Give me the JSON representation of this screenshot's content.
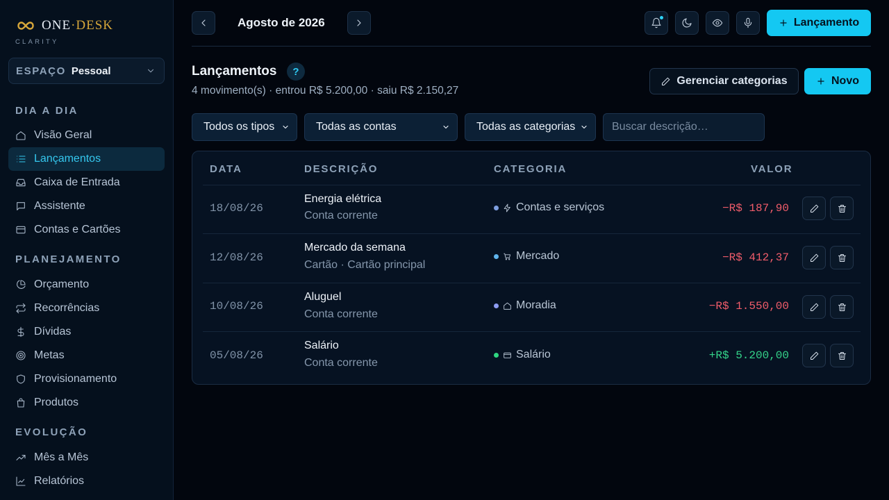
{
  "brand": {
    "name_left": "ONE",
    "name_dot": "·",
    "name_right": "DESK",
    "subtitle": "CLARITY"
  },
  "space": {
    "label": "ESPAÇO",
    "value": "Pessoal"
  },
  "sidebar": {
    "sections": [
      {
        "title": "DIA A DIA"
      },
      {
        "title": "PLANEJAMENTO"
      },
      {
        "title": "EVOLUÇÃO"
      }
    ],
    "items": [
      {
        "label": "Visão Geral",
        "icon": "home-icon"
      },
      {
        "label": "Lançamentos",
        "icon": "list-icon",
        "active": true
      },
      {
        "label": "Caixa de Entrada",
        "icon": "inbox-icon"
      },
      {
        "label": "Assistente",
        "icon": "chat-icon"
      },
      {
        "label": "Contas e Cartões",
        "icon": "card-icon"
      },
      {
        "label": "Orçamento",
        "icon": "pie-icon"
      },
      {
        "label": "Recorrências",
        "icon": "repeat-icon"
      },
      {
        "label": "Dívidas",
        "icon": "dollar-icon"
      },
      {
        "label": "Metas",
        "icon": "target-icon"
      },
      {
        "label": "Provisionamento",
        "icon": "shield-icon"
      },
      {
        "label": "Produtos",
        "icon": "bag-icon"
      },
      {
        "label": "Mês a Mês",
        "icon": "trend-icon"
      },
      {
        "label": "Relatórios",
        "icon": "chart-icon"
      }
    ]
  },
  "topbar": {
    "month": "Agosto de 2026",
    "new_entry_label": "Lançamento"
  },
  "page": {
    "title": "Lançamentos",
    "help": "?",
    "summary": "4 movimento(s) · entrou R$ 5.200,00 · saiu R$ 2.150,27",
    "manage_categories_label": "Gerenciar categorias",
    "new_label": "Novo"
  },
  "filters": {
    "types": "Todos os tipos",
    "accounts": "Todas as contas",
    "categories": "Todas as categorias",
    "search_placeholder": "Buscar descrição…"
  },
  "table": {
    "headers": {
      "date": "DATA",
      "description": "DESCRIÇÃO",
      "category": "CATEGORIA",
      "value": "VALOR"
    },
    "rows": [
      {
        "date": "18/08/26",
        "description": "Energia elétrica",
        "account": "Conta corrente",
        "category": "Contas e serviços",
        "category_icon": "bolt-icon",
        "dot_color": "#7d9ee0",
        "amount": "−R$ 187,90",
        "amount_color": "#f05c6a"
      },
      {
        "date": "12/08/26",
        "description": "Mercado da semana",
        "account": "Cartão · Cartão principal",
        "category": "Mercado",
        "category_icon": "cart-icon",
        "dot_color": "#5fb4ec",
        "amount": "−R$ 412,37",
        "amount_color": "#f05c6a"
      },
      {
        "date": "10/08/26",
        "description": "Aluguel",
        "account": "Conta corrente",
        "category": "Moradia",
        "category_icon": "house-icon",
        "dot_color": "#8d9cf2",
        "amount": "−R$ 1.550,00",
        "amount_color": "#f05c6a"
      },
      {
        "date": "05/08/26",
        "description": "Salário",
        "account": "Conta corrente",
        "category": "Salário",
        "category_icon": "wallet-icon",
        "dot_color": "#2fd681",
        "amount": "+R$ 5.200,00",
        "amount_color": "#34d48a"
      }
    ]
  }
}
